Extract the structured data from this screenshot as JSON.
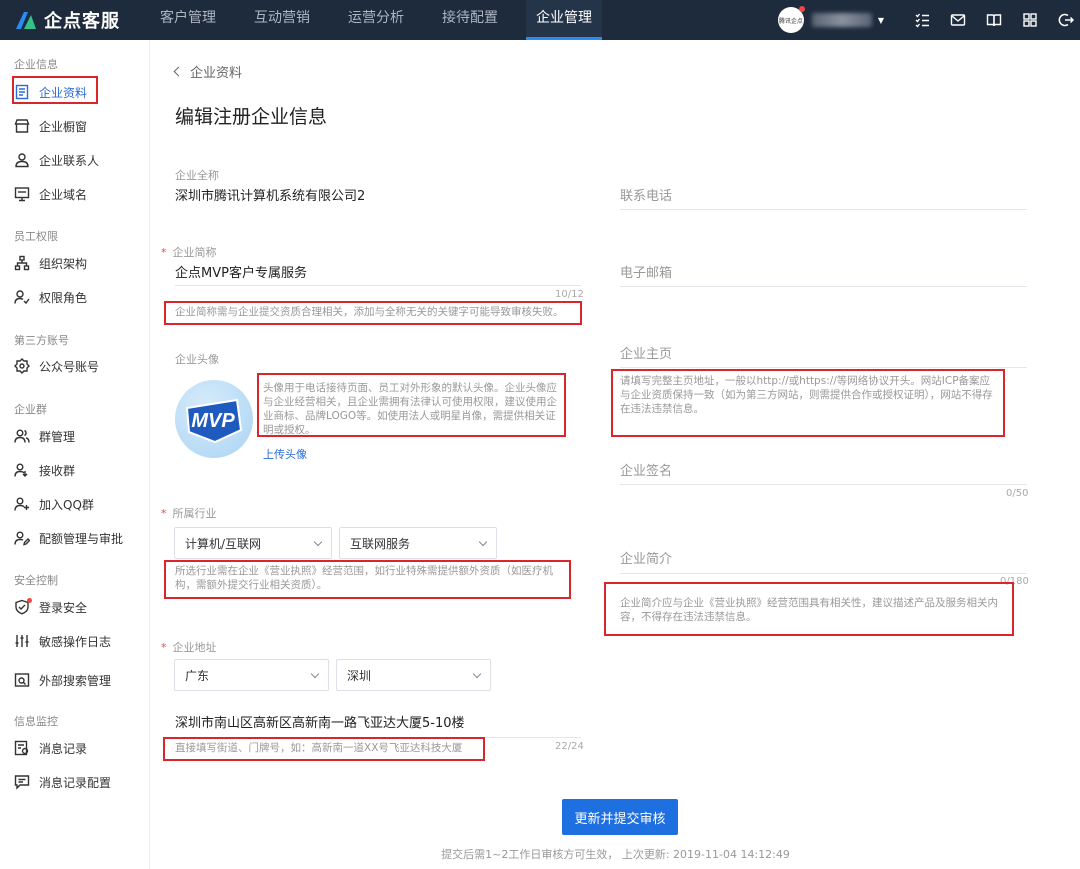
{
  "brand": {
    "name": "企点客服"
  },
  "topnav": [
    "客户管理",
    "互动营销",
    "运营分析",
    "接待配置",
    "企业管理"
  ],
  "header": {
    "avatar_text": "腾讯企点"
  },
  "sidebar": {
    "groups": [
      "企业信息",
      "员工权限",
      "第三方账号",
      "企业群",
      "安全控制",
      "信息监控"
    ],
    "items": [
      "企业资料",
      "企业橱窗",
      "企业联系人",
      "企业域名",
      "组织架构",
      "权限角色",
      "公众号账号",
      "群管理",
      "接收群",
      "加入QQ群",
      "配额管理与审批",
      "登录安全",
      "敏感操作日志",
      "外部搜索管理",
      "消息记录",
      "消息记录配置"
    ]
  },
  "page": {
    "back": "企业资料",
    "title": "编辑注册企业信息",
    "full_name_label": "企业全称",
    "full_name_value": "深圳市腾讯计算机系统有限公司2",
    "short_name_label": "企业简称",
    "short_name_value": "企点MVP客户专属服务",
    "short_name_counter": "10/12",
    "short_name_hint": "企业简称需与企业提交资质合理相关，添加与全称无关的关键字可能导致审核失败。",
    "avatar_label": "企业头像",
    "avatar_hint": "头像用于电话接待页面、员工对外形象的默认头像。企业头像应与企业经营相关，且企业需拥有法律认可使用权限，建议使用企业商标、品牌LOGO等。如使用法人或明星肖像，需提供相关证明或授权。",
    "avatar_image_text": "MVP",
    "upload_avatar": "上传头像",
    "industry_label": "所属行业",
    "industry_primary": "计算机/互联网",
    "industry_secondary": "互联网服务",
    "industry_hint": "所选行业需在企业《营业执照》经营范围，如行业特殊需提供额外资质（如医疗机构，需额外提交行业相关资质）。",
    "address_label": "企业地址",
    "province": "广东",
    "city": "深圳",
    "address_value": "深圳市南山区高新区高新南一路飞亚达大厦5-10楼",
    "address_counter": "22/24",
    "address_hint": "直接填写街道、门牌号，如：高新南一道XX号飞亚达科技大厦",
    "phone_label": "联系电话",
    "email_label": "电子邮箱",
    "homepage_label": "企业主页",
    "homepage_hint": "请填写完整主页地址，一般以http://或https://等网络协议开头。网站ICP备案应与企业资质保持一致（如为第三方网站，则需提供合作或授权证明），网站不得存在违法违禁信息。",
    "signature_label": "企业签名",
    "signature_counter": "0/50",
    "intro_label": "企业简介",
    "intro_counter": "0/180",
    "intro_hint": "企业简介应与企业《营业执照》经营范围具有相关性，建议描述产品及服务相关内容，不得存在违法违禁信息。",
    "submit": "更新并提交审核",
    "footer_note": "提交后需1~2工作日审核方可生效， 上次更新: 2019-11-04 14:12:49"
  },
  "colors": {
    "topbar": "#1d2b3d",
    "accent": "#1e6fe0",
    "annotation": "#d9262c"
  }
}
